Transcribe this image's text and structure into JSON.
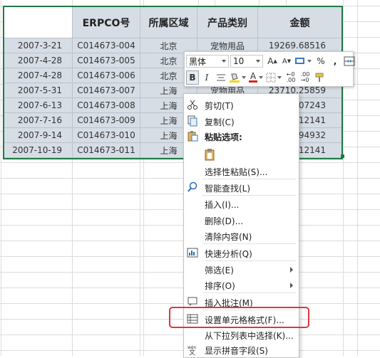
{
  "table": {
    "headers": [
      "",
      "ERPCO号",
      "所属区域",
      "产品类别",
      "金额"
    ],
    "rows": [
      [
        "2007-3-21",
        "C014673-004",
        "北京",
        "宠物用品",
        "19269.68516"
      ],
      [
        "2007-4-28",
        "C014673-005",
        "北京",
        "",
        ""
      ],
      [
        "2007-4-28",
        "C014673-006",
        "北京",
        "",
        ""
      ],
      [
        "2007-5-31",
        "C014673-007",
        "上海",
        "宠物用品",
        "23710.25859"
      ],
      [
        "2007-6-13",
        "C014673-008",
        "上海",
        "",
        "07243"
      ],
      [
        "2007-7-16",
        "C014673-009",
        "上海",
        "",
        "12141"
      ],
      [
        "2007-9-14",
        "C014673-010",
        "上海",
        "",
        "94932"
      ],
      [
        "2007-10-19",
        "C014673-011",
        "上海",
        "",
        "12141"
      ]
    ]
  },
  "mini_toolbar": {
    "font_name": "黑体",
    "font_size": "10",
    "grow_font": "A",
    "shrink_font": "A",
    "percent": "%",
    "comma": ",",
    "bold": "B",
    "italic": "I",
    "font_color_letter": "A"
  },
  "context_menu": {
    "items": [
      {
        "label": "剪切(T)",
        "icon": "scissors-icon"
      },
      {
        "label": "复制(C)",
        "icon": "copy-icon"
      },
      {
        "label": "粘贴选项:",
        "icon": "paste-icon"
      },
      {
        "label": "",
        "icon": "paste-option-icon"
      },
      {
        "label": "选择性粘贴(S)...",
        "icon": ""
      },
      {
        "label": "智能查找(L)",
        "icon": "smart-lookup-icon"
      },
      {
        "label": "插入(I)...",
        "icon": ""
      },
      {
        "label": "删除(D)...",
        "icon": ""
      },
      {
        "label": "清除内容(N)",
        "icon": ""
      },
      {
        "label": "快速分析(Q)",
        "icon": "quick-analysis-icon"
      },
      {
        "label": "筛选(E)",
        "icon": ""
      },
      {
        "label": "排序(O)",
        "icon": ""
      },
      {
        "label": "插入批注(M)",
        "icon": "comment-icon"
      },
      {
        "label": "设置单元格格式(F)...",
        "icon": "format-cells-icon"
      },
      {
        "label": "从下拉列表中选择(K)...",
        "icon": ""
      },
      {
        "label": "显示拼音字段(S)",
        "icon": "phonetic-icon"
      }
    ]
  },
  "colors": {
    "selection_border": "#1f7a45",
    "cell_fill": "#d6dde5",
    "highlight_box": "#e0363d"
  }
}
